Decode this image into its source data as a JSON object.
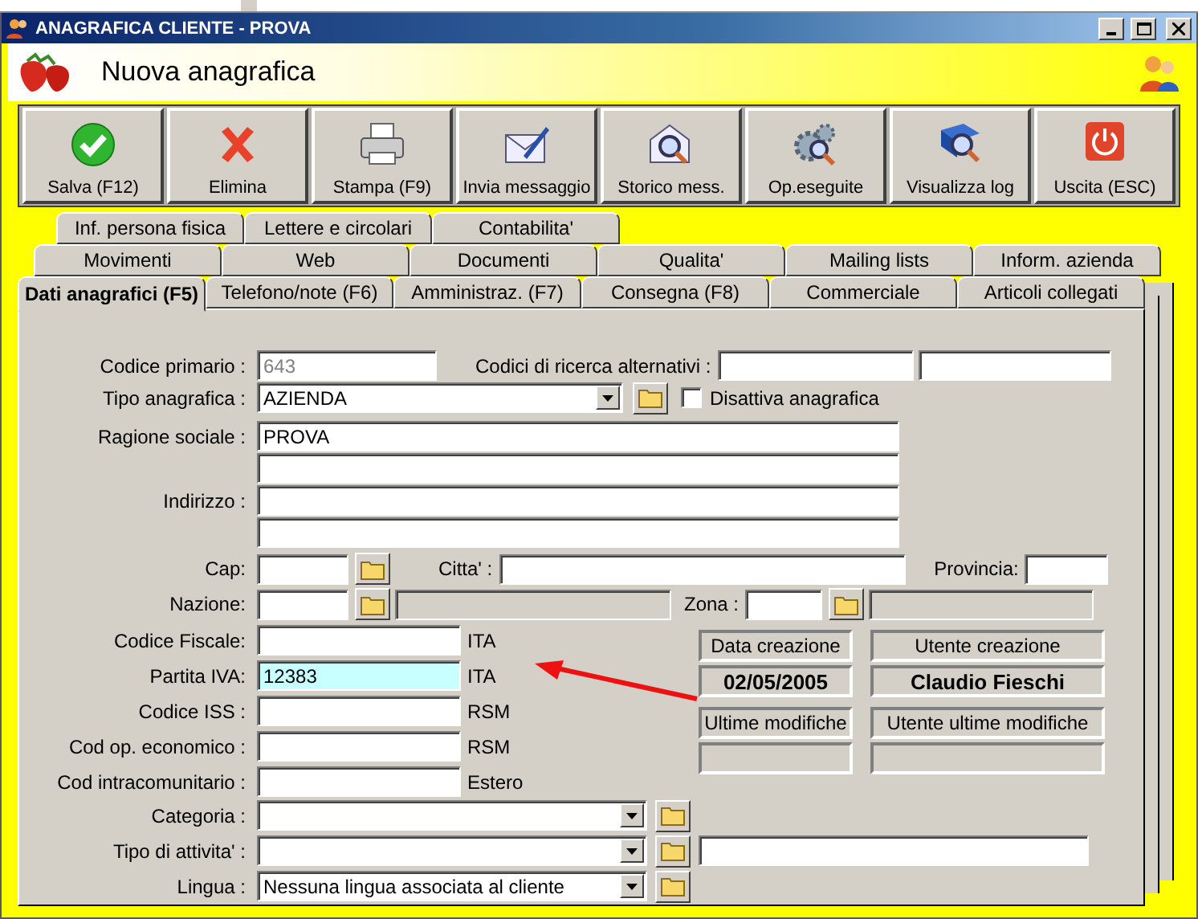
{
  "window": {
    "title": "ANAGRAFICA CLIENTE - PROVA"
  },
  "header": {
    "title": "Nuova anagrafica"
  },
  "toolbar": [
    {
      "label": "Salva (F12)",
      "kind": "save"
    },
    {
      "label": "Elimina",
      "kind": "delete"
    },
    {
      "label": "Stampa (F9)",
      "kind": "print"
    },
    {
      "label": "Invia messaggio",
      "kind": "send"
    },
    {
      "label": "Storico mess.",
      "kind": "history"
    },
    {
      "label": "Op.eseguite",
      "kind": "ops"
    },
    {
      "label": "Visualizza log",
      "kind": "log"
    },
    {
      "label": "Uscita (ESC)",
      "kind": "exit"
    }
  ],
  "tab_rows": [
    {
      "tabs": [
        {
          "label": "Inf. persona fisica",
          "selected": false
        },
        {
          "label": "Lettere e circolari",
          "selected": false
        },
        {
          "label": "Contabilita'",
          "selected": false
        }
      ]
    },
    {
      "tabs": [
        {
          "label": "Movimenti",
          "selected": false
        },
        {
          "label": "Web",
          "selected": false
        },
        {
          "label": "Documenti",
          "selected": false
        },
        {
          "label": "Qualita'",
          "selected": false
        },
        {
          "label": "Mailing lists",
          "selected": false
        },
        {
          "label": "Inform. azienda",
          "selected": false
        }
      ]
    },
    {
      "tabs": [
        {
          "label": "Dati anagrafici (F5)",
          "selected": true
        },
        {
          "label": "Telefono/note (F6)",
          "selected": false
        },
        {
          "label": "Amministraz. (F7)",
          "selected": false
        },
        {
          "label": "Consegna (F8)",
          "selected": false
        },
        {
          "label": "Commerciale",
          "selected": false
        },
        {
          "label": "Articoli collegati",
          "selected": false
        }
      ]
    }
  ],
  "form": {
    "codice_primario": {
      "label": "Codice primario :",
      "value": "643",
      "disabled": true
    },
    "codici_alternativi": {
      "label": "Codici di ricerca alternativi :"
    },
    "tipo_anagrafica": {
      "label": "Tipo anagrafica :",
      "value": "AZIENDA"
    },
    "disattiva": {
      "label": "Disattiva anagrafica",
      "checked": false
    },
    "ragione_sociale": {
      "label": "Ragione sociale :",
      "value": "PROVA"
    },
    "indirizzo": {
      "label": "Indirizzo :"
    },
    "cap": {
      "label": "Cap:"
    },
    "citta": {
      "label": "Citta' :"
    },
    "provincia": {
      "label": "Provincia:"
    },
    "nazione": {
      "label": "Nazione:"
    },
    "zona": {
      "label": "Zona :"
    },
    "codes": [
      {
        "label": "Codice Fiscale:",
        "suffix": "ITA",
        "highlighted": false
      },
      {
        "label": "Partita IVA:",
        "value": "12383",
        "suffix": "ITA",
        "highlighted": true
      },
      {
        "label": "Codice ISS :",
        "suffix": "RSM",
        "highlighted": false
      },
      {
        "label": "Cod  op. economico :",
        "suffix": "RSM",
        "highlighted": false
      },
      {
        "label": "Cod  intracomunitario :",
        "suffix": "Estero",
        "highlighted": false
      }
    ],
    "info": [
      {
        "label": "Data creazione",
        "value": "02/05/2005"
      },
      {
        "label": "Utente creazione",
        "value": "Claudio Fieschi"
      },
      {
        "label": "Ultime modifiche"
      },
      {
        "label": "Utente ultime modifiche"
      }
    ],
    "dropdowns": [
      {
        "label": "Categoria :",
        "extra_field": false
      },
      {
        "label": "Tipo di attivita' :",
        "extra_field": true
      },
      {
        "label": "Lingua :",
        "value": "Nessuna lingua associata al cliente",
        "extra_field": false
      }
    ]
  }
}
